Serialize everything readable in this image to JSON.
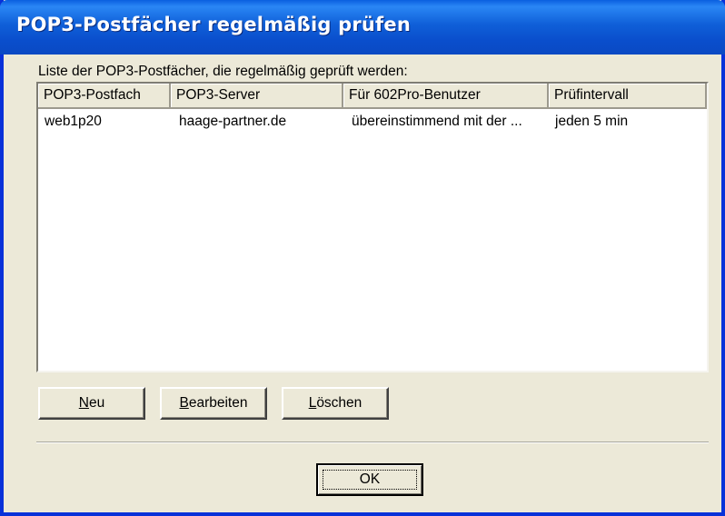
{
  "window": {
    "title": "POP3-Postfächer regelmäßig prüfen",
    "accent": "#0a4ecc",
    "background": "#ece9d8"
  },
  "list": {
    "caption": "Liste der POP3-Postfächer, die regelmäßig geprüft werden:",
    "columns": [
      "POP3-Postfach",
      "POP3-Server",
      "Für 602Pro-Benutzer",
      "Prüfintervall"
    ],
    "rows": [
      [
        "web1p20",
        "haage-partner.de",
        "übereinstimmend mit der ...",
        "jeden 5 min"
      ]
    ]
  },
  "buttons": {
    "new_mnemonic": "N",
    "new_rest": "eu",
    "edit_mnemonic": "B",
    "edit_rest": "earbeiten",
    "delete_mnemonic": "L",
    "delete_rest": "öschen",
    "ok_label": "OK"
  }
}
